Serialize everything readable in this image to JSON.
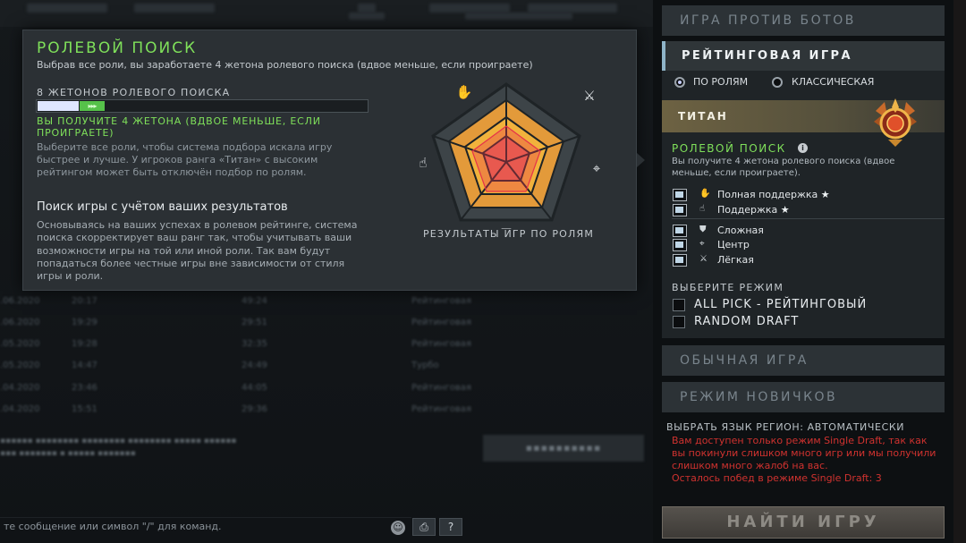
{
  "popup": {
    "title": "РОЛЕВОЙ ПОИСК",
    "subtitle": "Выбрав все роли, вы заработаете 4 жетона ролевого поиска (вдвое меньше, если проиграете)",
    "tokens_label": "8 ЖЕТОНОВ РОЛЕВОГО ПОИСКА",
    "token_bar": {
      "current": 2,
      "gain": 1,
      "max": 8,
      "gain_glyph": "▸▸▸"
    },
    "gain_text": "ВЫ ПОЛУЧИТЕ 4 ЖЕТОНА (ВДВОЕ МЕНЬШЕ, ЕСЛИ ПРОИГРАЕТЕ)",
    "hint_text": "Выберите все роли, чтобы система подбора искала игру быстрее и лучше. У игроков ранга «Титан» с высоким рейтингом может быть отключён подбор по ролям.",
    "section_title": "Поиск игры с учётом ваших результатов",
    "section_body": "Основываясь на ваших успехах в ролевом рейтинге, система поиска скорректирует ваш ранг так, чтобы учитывать ваши возможности игры на той или иной роли. Так вам будут попадаться более честные игры вне зависимости от стиля игры и роли.",
    "radar_caption": "РЕЗУЛЬТАТЫ ИГР ПО РОЛЯМ",
    "radar_icons": [
      "hand-sparkle-icon",
      "sword-icon",
      "bow-icon",
      "shield-icon",
      "hand-icon"
    ]
  },
  "modes": {
    "bots": "ИГРА ПРОТИВ БОТОВ",
    "ranked": "РЕЙТИНГОВАЯ ИГРА",
    "normal": "ОБЫЧНАЯ ИГРА",
    "newbie": "РЕЖИМ НОВИЧКОВ"
  },
  "ranked": {
    "radio_roles": "ПО РОЛЯМ",
    "radio_classic": "КЛАССИЧЕСКАЯ",
    "selected_radio": "roles",
    "tier": "ТИТАН",
    "role_queue_title": "РОЛЕВОЙ ПОИСК",
    "role_queue_desc": "Вы получите 4 жетона ролевого поиска (вдвое меньше, если проиграете).",
    "roles": [
      {
        "icon": "✋",
        "label": "Полная поддержка",
        "star": "★"
      },
      {
        "icon": "☝",
        "label": "Поддержка",
        "star": "★"
      },
      {
        "icon": "⛊",
        "label": "Сложная",
        "star": ""
      },
      {
        "icon": "⌖",
        "label": "Центр",
        "star": ""
      },
      {
        "icon": "⚔",
        "label": "Лёгкая",
        "star": ""
      }
    ],
    "mode_select_label": "ВЫБЕРИТЕ РЕЖИМ",
    "mode_options": [
      "ALL PICK - РЕЙТИНГОВЫЙ",
      "RANDOM DRAFT"
    ]
  },
  "footer": {
    "lang_region": "ВЫБРАТЬ ЯЗЫК   РЕГИОН: АВТОМАТИЧЕСКИ",
    "warning": "Вам доступен только режим Single Draft, так как вы покинули слишком много игр или мы получили слишком много жалоб на вас.",
    "warning_count": "Осталось побед в режиме Single Draft: 3",
    "find_game": "НАЙТИ ИГРУ"
  },
  "chat": {
    "placeholder": "те сообщение или символ \"/\" для команд.",
    "help": "?"
  },
  "colors": {
    "accent_green": "#7fe05a",
    "warning_red": "#d0322f",
    "panel": "#2b3034"
  }
}
